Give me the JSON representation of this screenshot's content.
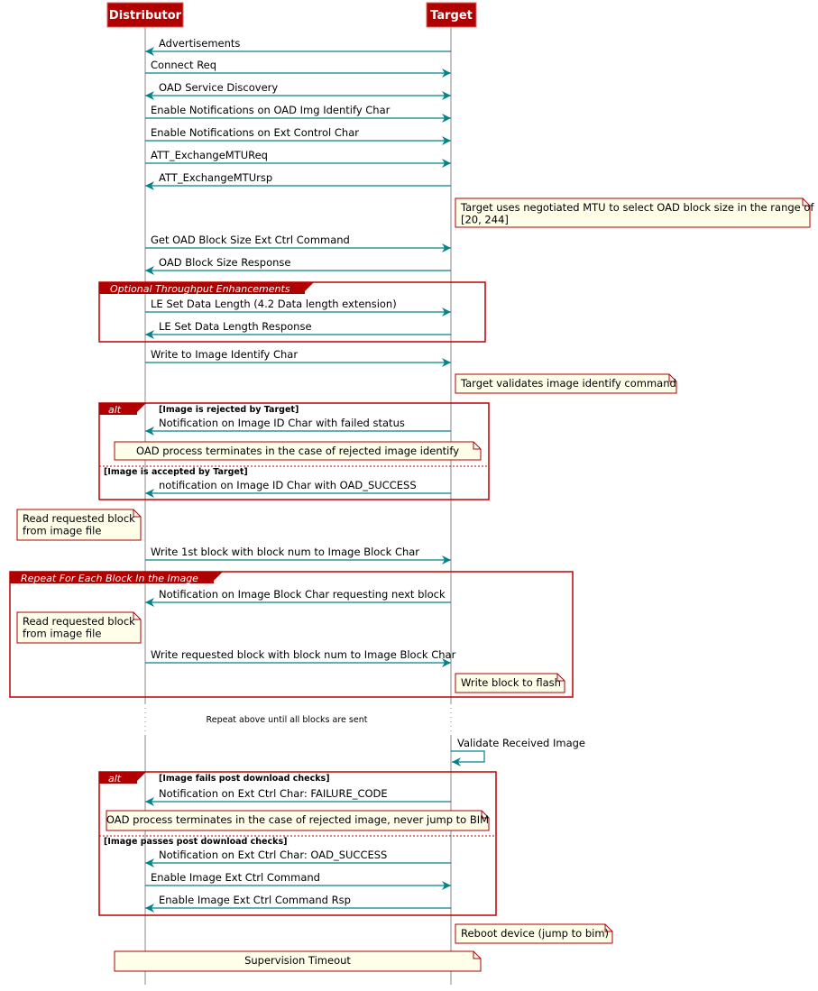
{
  "colors": {
    "participant": "#b00000",
    "arrow": "#00838a",
    "group_border": "#c00000",
    "note_fill": "#fefee9",
    "note_border": "#b00000",
    "lifeline": "#888888"
  },
  "participants": [
    {
      "id": "D",
      "name": "Distributor"
    },
    {
      "id": "T",
      "name": "Target"
    }
  ],
  "messages": [
    {
      "from": "T",
      "to": "D",
      "text": "Advertisements"
    },
    {
      "from": "D",
      "to": "T",
      "text": "Connect Req"
    },
    {
      "from": "both",
      "to": "both",
      "text": "OAD Service Discovery"
    },
    {
      "from": "D",
      "to": "T",
      "text": "Enable Notifications on OAD Img Identify Char"
    },
    {
      "from": "D",
      "to": "T",
      "text": "Enable Notifications on Ext Control Char"
    },
    {
      "from": "D",
      "to": "T",
      "text": "ATT_ExchangeMTUReq"
    },
    {
      "from": "T",
      "to": "D",
      "text": "ATT_ExchangeMTUrsp"
    },
    {
      "from": "D",
      "to": "T",
      "text": "Get OAD Block Size Ext Ctrl Command"
    },
    {
      "from": "T",
      "to": "D",
      "text": "OAD Block Size Response"
    },
    {
      "from": "D",
      "to": "T",
      "text": "LE Set Data Length (4.2 Data length extension)"
    },
    {
      "from": "T",
      "to": "D",
      "text": "LE Set Data Length Response"
    },
    {
      "from": "D",
      "to": "T",
      "text": "Write to Image Identify Char"
    },
    {
      "from": "T",
      "to": "D",
      "text": "Notification on Image ID Char with failed status"
    },
    {
      "from": "T",
      "to": "D",
      "text": "notification on Image ID Char with OAD_SUCCESS"
    },
    {
      "from": "D",
      "to": "T",
      "text": "Write 1st block with block num to Image Block Char"
    },
    {
      "from": "T",
      "to": "D",
      "text": "Notification on Image Block Char requesting next block"
    },
    {
      "from": "D",
      "to": "T",
      "text": "Write requested block with block num to Image Block Char"
    },
    {
      "from": "T",
      "to": "T",
      "text": "Validate Received Image"
    },
    {
      "from": "T",
      "to": "D",
      "text": "Notification on Ext Ctrl Char: FAILURE_CODE"
    },
    {
      "from": "T",
      "to": "D",
      "text": "Notification on Ext Ctrl Char: OAD_SUCCESS"
    },
    {
      "from": "D",
      "to": "T",
      "text": "Enable Image Ext Ctrl Command"
    },
    {
      "from": "T",
      "to": "D",
      "text": "Enable Image Ext Ctrl Command Rsp"
    }
  ],
  "notes": [
    {
      "position": "right of Target",
      "lines": [
        "Target uses negotiated MTU to select OAD block size in the range of",
        "[20, 244]"
      ]
    },
    {
      "position": "right of Target",
      "lines": [
        "Target validates image identify command"
      ]
    },
    {
      "position": "over Distributor,Target",
      "lines": [
        "OAD process terminates in the case of rejected image identify"
      ]
    },
    {
      "position": "left of Distributor",
      "lines": [
        "Read requested block",
        "from image file"
      ]
    },
    {
      "position": "left of Distributor",
      "lines": [
        "Read requested block",
        "from image file"
      ]
    },
    {
      "position": "right of Target",
      "lines": [
        "Write block to flash"
      ]
    },
    {
      "position": "over Distributor,Target",
      "lines": [
        "OAD process terminates in the case of rejected image, never jump to BIM"
      ]
    },
    {
      "position": "right of Target",
      "lines": [
        "Reboot device (jump to bim)"
      ]
    },
    {
      "position": "over Distributor,Target",
      "lines": [
        "Supervision Timeout"
      ]
    }
  ],
  "groups": [
    {
      "label": "Optional Throughput Enhancements",
      "conditions": []
    },
    {
      "label": "alt",
      "conditions": [
        "[Image is rejected by Target]",
        "[Image is accepted by Target]"
      ]
    },
    {
      "label": "Repeat For Each Block In the Image",
      "conditions": []
    },
    {
      "label": "alt",
      "conditions": [
        "[Image fails post download checks]",
        "[Image passes post download checks]"
      ]
    }
  ],
  "delay": {
    "text": "Repeat above until all blocks are sent"
  }
}
